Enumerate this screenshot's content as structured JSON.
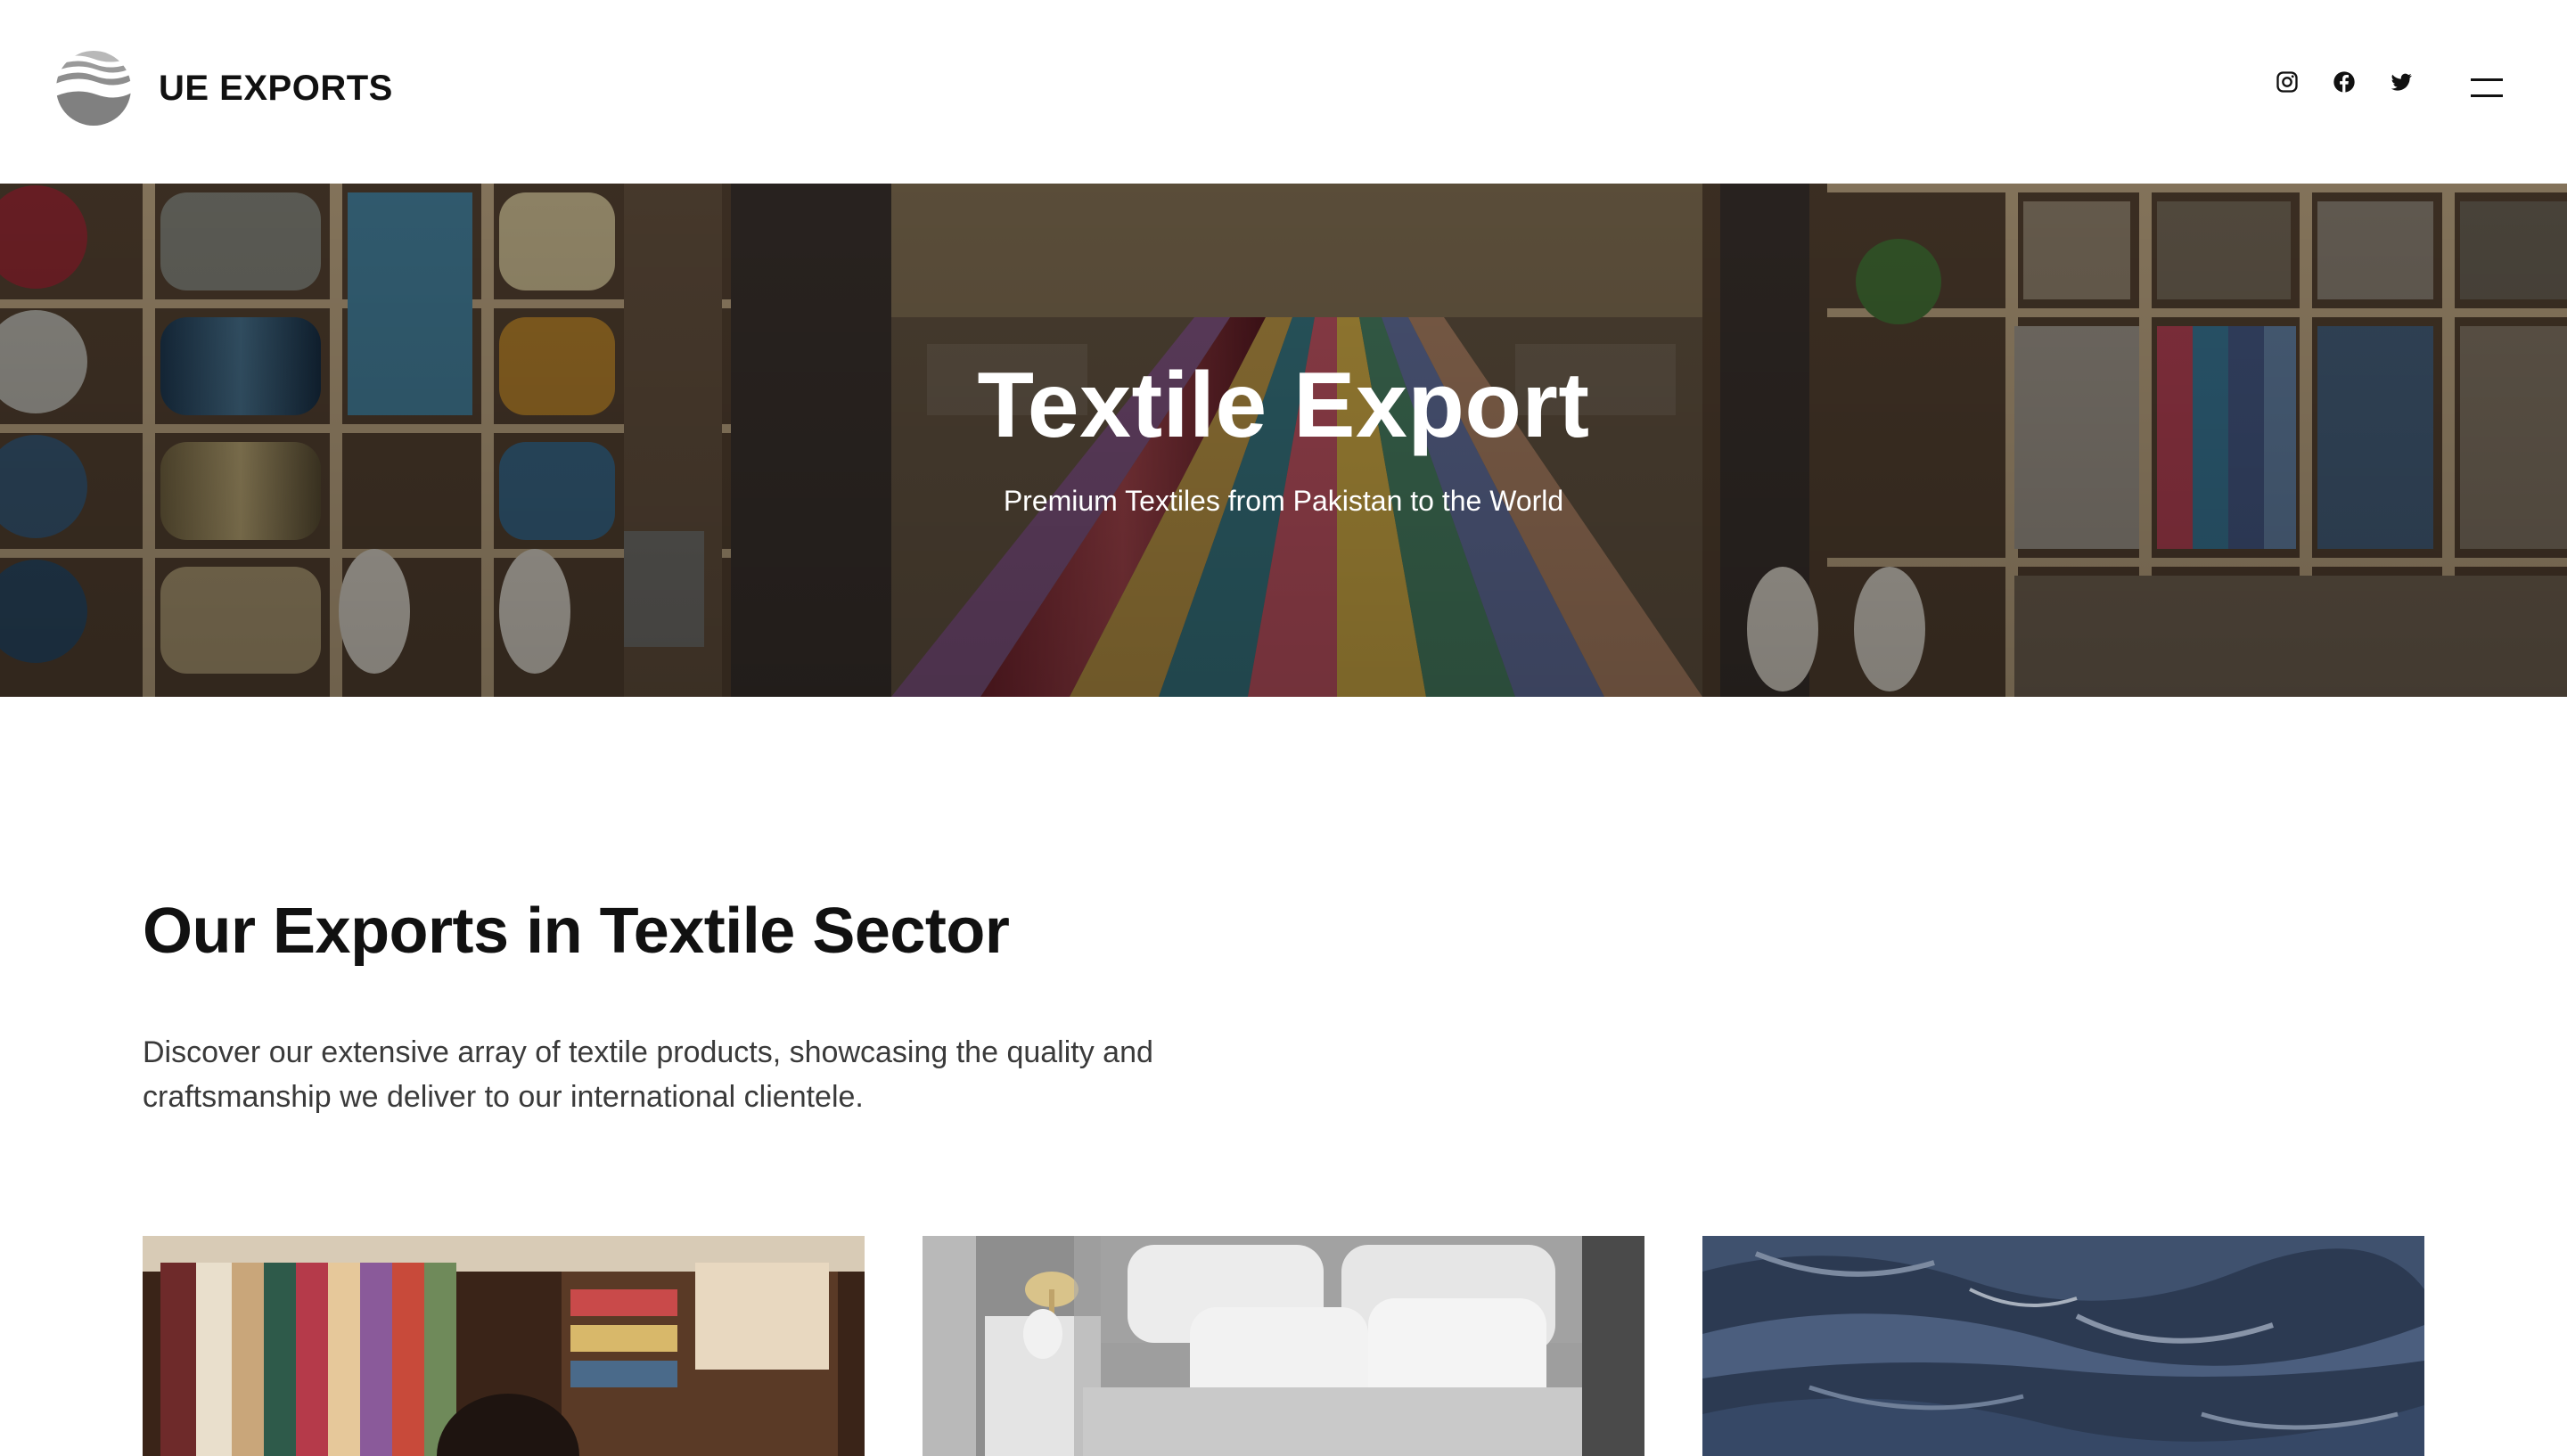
{
  "header": {
    "brand": "UE EXPORTS",
    "logo_icon": "wave-globe-logo",
    "social_icons": [
      "instagram-icon",
      "facebook-icon",
      "twitter-icon"
    ],
    "menu_icon": "hamburger-menu-icon"
  },
  "hero": {
    "title": "Textile Export",
    "subtitle": "Premium Textiles from Pakistan to the World"
  },
  "section": {
    "title": "Our Exports in Textile Sector",
    "description": "Discover our extensive array of textile products, showcasing the quality and craftsmanship we deliver to our international clientele."
  },
  "cards": [
    {
      "image": "garment-shop-image"
    },
    {
      "image": "bedding-image"
    },
    {
      "image": "denim-fabric-image"
    }
  ],
  "colors": {
    "text": "#111111",
    "body_text": "#3a3a3a",
    "background": "#ffffff",
    "hero_overlay": "#000000"
  }
}
